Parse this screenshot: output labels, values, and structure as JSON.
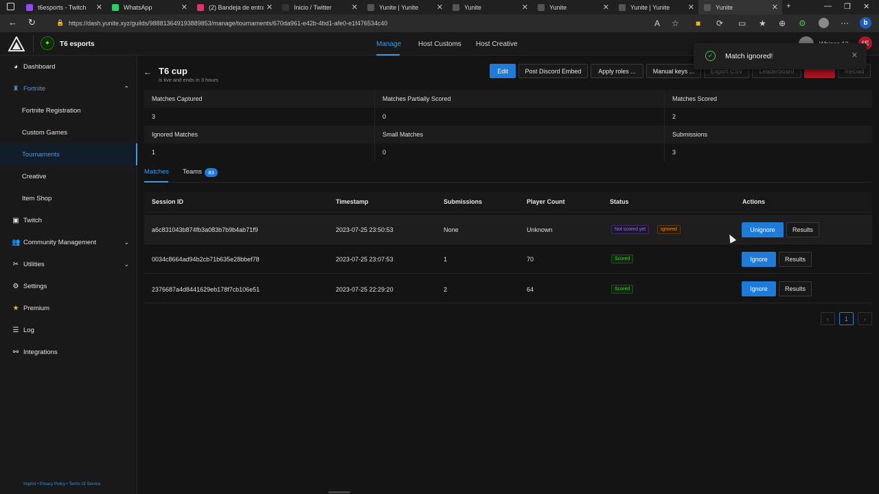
{
  "browser": {
    "tabs": [
      {
        "label": "t6esports - Twitch",
        "color": "#9146ff"
      },
      {
        "label": "WhatsApp",
        "color": "#25d366"
      },
      {
        "label": "(2) Bandeja de entrada",
        "color": "#e1306c"
      },
      {
        "label": "Inicio / Twitter",
        "color": "#333333"
      },
      {
        "label": "Yunite | Yunite",
        "color": "#555555"
      },
      {
        "label": "Yunite",
        "color": "#555555"
      },
      {
        "label": "Yunite",
        "color": "#555555"
      },
      {
        "label": "Yunite | Yunite",
        "color": "#555555"
      },
      {
        "label": "Yunite",
        "color": "#555555"
      }
    ],
    "url": "https://dash.yunite.xyz/guilds/988813649193889853/manage/tournaments/670da961-e42b-4bd1-afe0-e1f476534c40"
  },
  "header": {
    "guild_name": "T6 esports",
    "nav": [
      "Manage",
      "Host Customs",
      "Host Creative"
    ],
    "username": "Whiens 12",
    "user_initials": "6E"
  },
  "sidebar": {
    "items": [
      {
        "label": "Dashboard",
        "icon": "palette-icon"
      },
      {
        "label": "Fortnite",
        "icon": "fortnite-icon"
      },
      {
        "label": "Fortnite Registration"
      },
      {
        "label": "Custom Games"
      },
      {
        "label": "Tournaments"
      },
      {
        "label": "Creative"
      },
      {
        "label": "Item Shop"
      },
      {
        "label": "Twitch",
        "icon": "twitch-icon"
      },
      {
        "label": "Community Management",
        "icon": "users-icon"
      },
      {
        "label": "Utilities",
        "icon": "tools-icon"
      },
      {
        "label": "Settings",
        "icon": "gear-icon"
      },
      {
        "label": "Premium",
        "icon": "star-icon"
      },
      {
        "label": "Log",
        "icon": "list-icon"
      },
      {
        "label": "Integrations",
        "icon": "integrations-icon"
      }
    ],
    "footer": {
      "imprint": "Imprint",
      "privacy": "Privacy Policy",
      "terms": "Terms Of Service"
    }
  },
  "page": {
    "title": "T6 cup",
    "subtitle": "is live and ends in 3 hours"
  },
  "toolbar": {
    "edit": "Edit",
    "post_discord": "Post Discord Embed",
    "apply_roles": "Apply roles ...",
    "manual_keys": "Manual keys ...",
    "export_csv": "Export CSV",
    "leaderboard": "Leaderboard",
    "reload": "Reload"
  },
  "stats": {
    "captured_label": "Matches Captured",
    "captured": "3",
    "partial_label": "Matches Partially Scored",
    "partial": "0",
    "scored_label": "Matches Scored",
    "scored": "2",
    "ignored_label": "Ignored Matches",
    "ignored": "1",
    "small_label": "Small Matches",
    "small": "0",
    "submissions_label": "Submissions",
    "submissions": "3"
  },
  "tabs": {
    "matches": "Matches",
    "teams": "Teams",
    "teams_count": "83"
  },
  "table": {
    "headers": [
      "Session ID",
      "Timestamp",
      "Submissions",
      "Player Count",
      "Status",
      "Actions"
    ],
    "rows": [
      {
        "session": "a6c831043b874fb3a083b7b9b4ab71f9",
        "timestamp": "2023-07-25 23:50:53",
        "submissions": "None",
        "players": "Unknown",
        "status1": "Not scored yet",
        "status2": "Ignored",
        "action": "Unignore",
        "results": "Results"
      },
      {
        "session": "0034c8664ad94b2cb71b635e28bbef78",
        "timestamp": "2023-07-25 23:07:53",
        "submissions": "1",
        "players": "70",
        "status1": "Scored",
        "action": "Ignore",
        "results": "Results"
      },
      {
        "session": "2376687a4d8441629eb178f7cb106e51",
        "timestamp": "2023-07-25 22:29:20",
        "submissions": "2",
        "players": "64",
        "status1": "Scored",
        "action": "Ignore",
        "results": "Results"
      }
    ]
  },
  "pagination": {
    "current": "1"
  },
  "toast": {
    "message": "Match ignored!"
  }
}
